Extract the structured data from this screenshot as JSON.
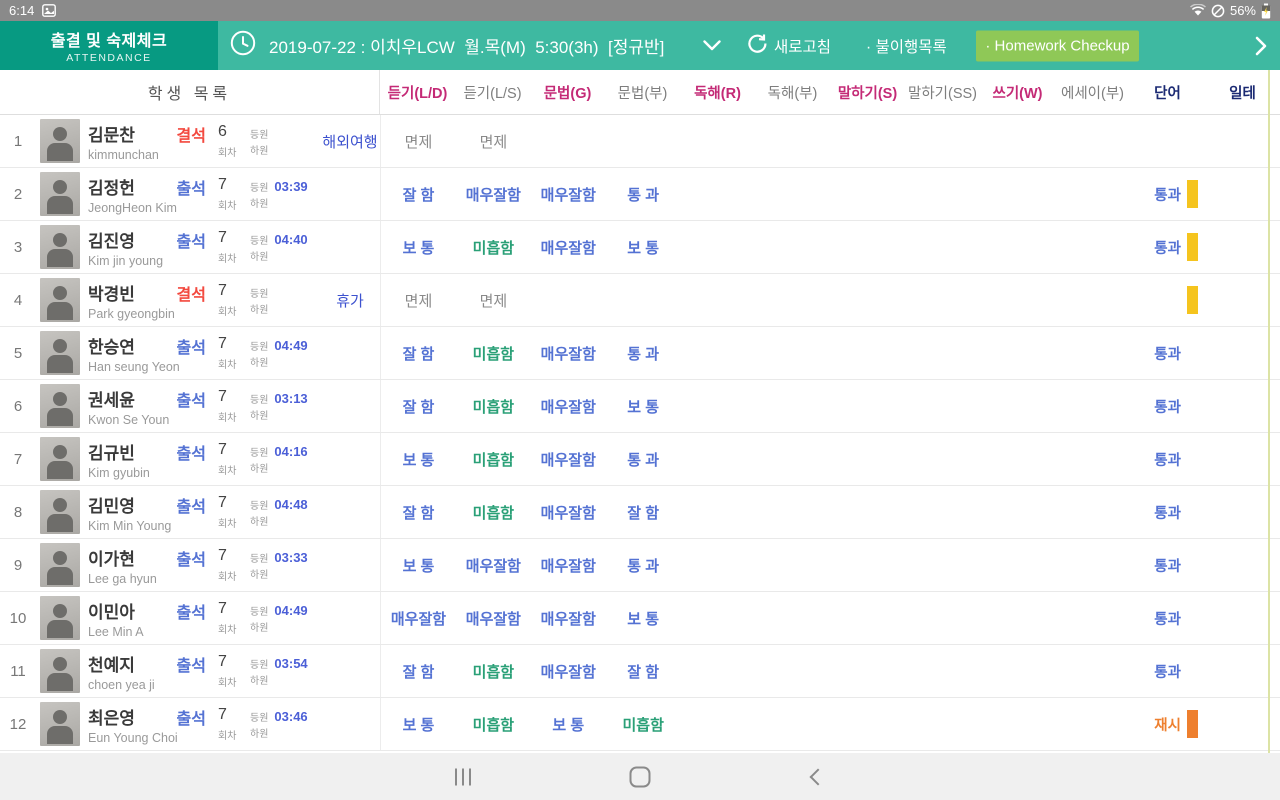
{
  "status_bar": {
    "time": "6:14",
    "battery_percent": "56%"
  },
  "app_bar": {
    "title": "출결 및 숙제체크",
    "subtitle": "ATTENDANCE",
    "session": "2019-07-22 : 이치우LCW  월.목(M)  5:30(3h)  [정규반]",
    "refresh": "새로고침",
    "noncompliance": "· 불이행목록",
    "homework_checkup": "· Homework Checkup"
  },
  "table": {
    "student_list_title": "학생 목록",
    "labels": {
      "count": "회차",
      "in": "등원",
      "out": "하원"
    },
    "columns": [
      {
        "label": "듣기(L/D)",
        "style": "accent"
      },
      {
        "label": "듣기(L/S)",
        "style": "muted"
      },
      {
        "label": "문법(G)",
        "style": "accent"
      },
      {
        "label": "문법(부)",
        "style": "muted"
      },
      {
        "label": "독해(R)",
        "style": "accent"
      },
      {
        "label": "독해(부)",
        "style": "muted"
      },
      {
        "label": "말하기(S)",
        "style": "accent"
      },
      {
        "label": "말하기(SS)",
        "style": "muted"
      },
      {
        "label": "쓰기(W)",
        "style": "accent"
      },
      {
        "label": "에세이(부)",
        "style": "muted"
      },
      {
        "label": "단어",
        "style": "navy"
      },
      {
        "label": "일테",
        "style": "navy"
      }
    ],
    "rows": [
      {
        "no": "1",
        "name": "김문찬",
        "eng_name": "kimmunchan",
        "status": "결석",
        "status_type": "absent",
        "count": "6",
        "in_time": "",
        "note": "해외여행",
        "grades": [
          {
            "t": "면제",
            "c": "gray"
          },
          {
            "t": "면제",
            "c": "gray"
          }
        ],
        "word": null,
        "badge": null
      },
      {
        "no": "2",
        "name": "김정헌",
        "eng_name": "JeongHeon Kim",
        "status": "출석",
        "status_type": "present",
        "count": "7",
        "in_time": "03:39",
        "note": "",
        "grades": [
          {
            "t": "잘 함",
            "c": "blue"
          },
          {
            "t": "매우잘함",
            "c": "blue"
          },
          {
            "t": "매우잘함",
            "c": "blue"
          },
          {
            "t": "통 과",
            "c": "blue"
          }
        ],
        "word": {
          "t": "통과",
          "c": "blue"
        },
        "badge": "yellow"
      },
      {
        "no": "3",
        "name": "김진영",
        "eng_name": "Kim jin young",
        "status": "출석",
        "status_type": "present",
        "count": "7",
        "in_time": "04:40",
        "note": "",
        "grades": [
          {
            "t": "보 통",
            "c": "blue"
          },
          {
            "t": "미흡함",
            "c": "green"
          },
          {
            "t": "매우잘함",
            "c": "blue"
          },
          {
            "t": "보 통",
            "c": "blue"
          }
        ],
        "word": {
          "t": "통과",
          "c": "blue"
        },
        "badge": "yellow"
      },
      {
        "no": "4",
        "name": "박경빈",
        "eng_name": "Park gyeongbin",
        "status": "결석",
        "status_type": "absent",
        "count": "7",
        "in_time": "",
        "note": "휴가",
        "grades": [
          {
            "t": "면제",
            "c": "gray"
          },
          {
            "t": "면제",
            "c": "gray"
          }
        ],
        "word": null,
        "badge": "yellow"
      },
      {
        "no": "5",
        "name": "한승연",
        "eng_name": "Han seung Yeon",
        "status": "출석",
        "status_type": "present",
        "count": "7",
        "in_time": "04:49",
        "note": "",
        "grades": [
          {
            "t": "잘 함",
            "c": "blue"
          },
          {
            "t": "미흡함",
            "c": "green"
          },
          {
            "t": "매우잘함",
            "c": "blue"
          },
          {
            "t": "통 과",
            "c": "blue"
          }
        ],
        "word": {
          "t": "통과",
          "c": "blue"
        },
        "badge": null
      },
      {
        "no": "6",
        "name": "권세윤",
        "eng_name": "Kwon Se Youn",
        "status": "출석",
        "status_type": "present",
        "count": "7",
        "in_time": "03:13",
        "note": "",
        "grades": [
          {
            "t": "잘 함",
            "c": "blue"
          },
          {
            "t": "미흡함",
            "c": "green"
          },
          {
            "t": "매우잘함",
            "c": "blue"
          },
          {
            "t": "보 통",
            "c": "blue"
          }
        ],
        "word": {
          "t": "통과",
          "c": "blue"
        },
        "badge": null
      },
      {
        "no": "7",
        "name": "김규빈",
        "eng_name": "Kim gyubin",
        "status": "출석",
        "status_type": "present",
        "count": "7",
        "in_time": "04:16",
        "note": "",
        "grades": [
          {
            "t": "보 통",
            "c": "blue"
          },
          {
            "t": "미흡함",
            "c": "green"
          },
          {
            "t": "매우잘함",
            "c": "blue"
          },
          {
            "t": "통 과",
            "c": "blue"
          }
        ],
        "word": {
          "t": "통과",
          "c": "blue"
        },
        "badge": null
      },
      {
        "no": "8",
        "name": "김민영",
        "eng_name": "Kim Min Young",
        "status": "출석",
        "status_type": "present",
        "count": "7",
        "in_time": "04:48",
        "note": "",
        "grades": [
          {
            "t": "잘 함",
            "c": "blue"
          },
          {
            "t": "미흡함",
            "c": "green"
          },
          {
            "t": "매우잘함",
            "c": "blue"
          },
          {
            "t": "잘 함",
            "c": "blue"
          }
        ],
        "word": {
          "t": "통과",
          "c": "blue"
        },
        "badge": null
      },
      {
        "no": "9",
        "name": "이가현",
        "eng_name": "Lee ga hyun",
        "status": "출석",
        "status_type": "present",
        "count": "7",
        "in_time": "03:33",
        "note": "",
        "grades": [
          {
            "t": "보 통",
            "c": "blue"
          },
          {
            "t": "매우잘함",
            "c": "blue"
          },
          {
            "t": "매우잘함",
            "c": "blue"
          },
          {
            "t": "통 과",
            "c": "blue"
          }
        ],
        "word": {
          "t": "통과",
          "c": "blue"
        },
        "badge": null
      },
      {
        "no": "10",
        "name": "이민아",
        "eng_name": "Lee Min A",
        "status": "출석",
        "status_type": "present",
        "count": "7",
        "in_time": "04:49",
        "note": "",
        "grades": [
          {
            "t": "매우잘함",
            "c": "blue"
          },
          {
            "t": "매우잘함",
            "c": "blue"
          },
          {
            "t": "매우잘함",
            "c": "blue"
          },
          {
            "t": "보 통",
            "c": "blue"
          }
        ],
        "word": {
          "t": "통과",
          "c": "blue"
        },
        "badge": null
      },
      {
        "no": "11",
        "name": "천예지",
        "eng_name": "choen yea ji",
        "status": "출석",
        "status_type": "present",
        "count": "7",
        "in_time": "03:54",
        "note": "",
        "grades": [
          {
            "t": "잘 함",
            "c": "blue"
          },
          {
            "t": "미흡함",
            "c": "green"
          },
          {
            "t": "매우잘함",
            "c": "blue"
          },
          {
            "t": "잘 함",
            "c": "blue"
          }
        ],
        "word": {
          "t": "통과",
          "c": "blue"
        },
        "badge": null
      },
      {
        "no": "12",
        "name": "최은영",
        "eng_name": "Eun Young Choi",
        "status": "출석",
        "status_type": "present",
        "count": "7",
        "in_time": "03:46",
        "note": "",
        "grades": [
          {
            "t": "보 통",
            "c": "blue"
          },
          {
            "t": "미흡함",
            "c": "green"
          },
          {
            "t": "보 통",
            "c": "blue"
          },
          {
            "t": "미흡함",
            "c": "green"
          }
        ],
        "word": {
          "t": "재시",
          "c": "orange"
        },
        "badge": "orange"
      }
    ]
  },
  "colors": {
    "app_bar_teal": "#3eb9a1",
    "app_bar_dark_teal": "#079a82",
    "homework_button_green": "#8fc857",
    "accent_pink": "#c42a76",
    "navy": "#1b2a73",
    "present_blue": "#5472d3",
    "absent_red": "#f3493f",
    "pass_green": "#2aa077",
    "retest_orange": "#ee7f2e",
    "badge_yellow": "#f5c41e"
  }
}
